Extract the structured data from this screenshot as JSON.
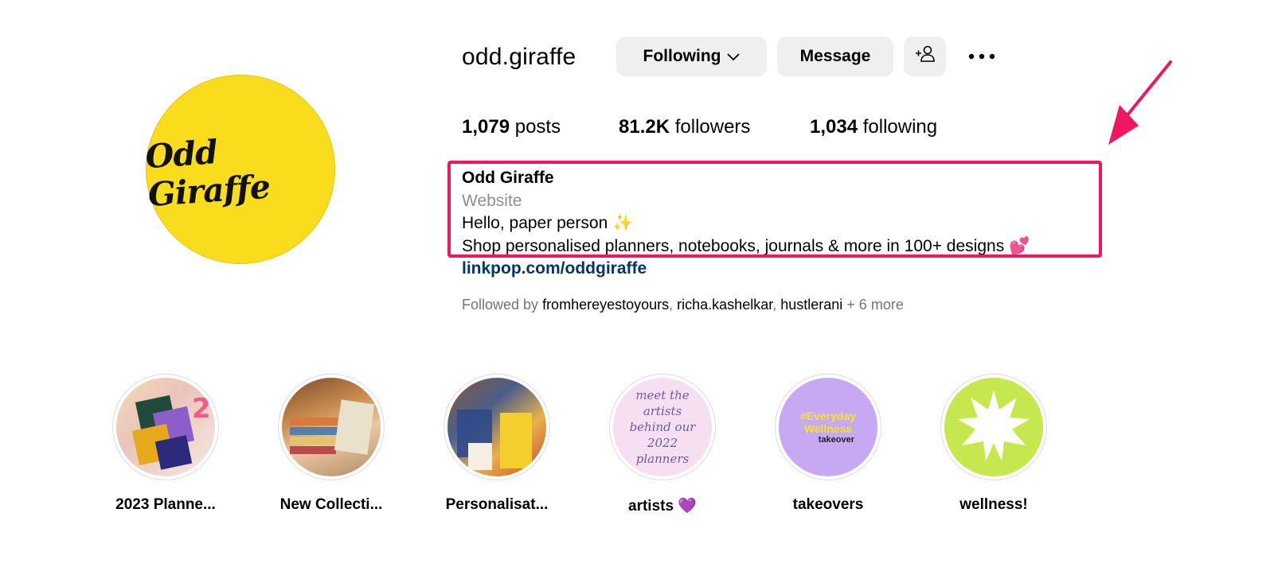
{
  "profile": {
    "username": "odd.giraffe",
    "avatar_text": "Odd Giraffe",
    "buttons": {
      "following": "Following",
      "message": "Message"
    },
    "stats": [
      {
        "value": "1,079",
        "label": "posts"
      },
      {
        "value": "81.2K",
        "label": "followers"
      },
      {
        "value": "1,034",
        "label": "following"
      }
    ],
    "bio": {
      "name": "Odd Giraffe",
      "category": "Website",
      "line1": "Hello, paper person ✨",
      "line2": "Shop personalised planners, notebooks, journals & more in 100+ designs 💕",
      "link": "linkpop.com/oddgiraffe"
    },
    "followed_by": {
      "prefix": "Followed by",
      "users": [
        "fromhereyestoyours",
        "richa.kashelkar",
        "hustlerani"
      ],
      "suffix": "+ 6 more"
    }
  },
  "highlights": [
    {
      "label": "2023 Planne..."
    },
    {
      "label": "New Collecti..."
    },
    {
      "label": "Personalisat..."
    },
    {
      "label": "artists 💜",
      "cover_text": [
        "meet the",
        "artists",
        "behind our",
        "2022",
        "planners"
      ]
    },
    {
      "label": "takeovers",
      "cover_text": [
        "#Everyday",
        "Wellness",
        "takeover"
      ]
    },
    {
      "label": "wellness!"
    }
  ],
  "annotation": {
    "color": "#f0175f"
  },
  "icons": [
    "chevron-down-icon",
    "add-person-icon",
    "more-icon",
    "arrow-annotation-icon",
    "starburst-icon"
  ]
}
